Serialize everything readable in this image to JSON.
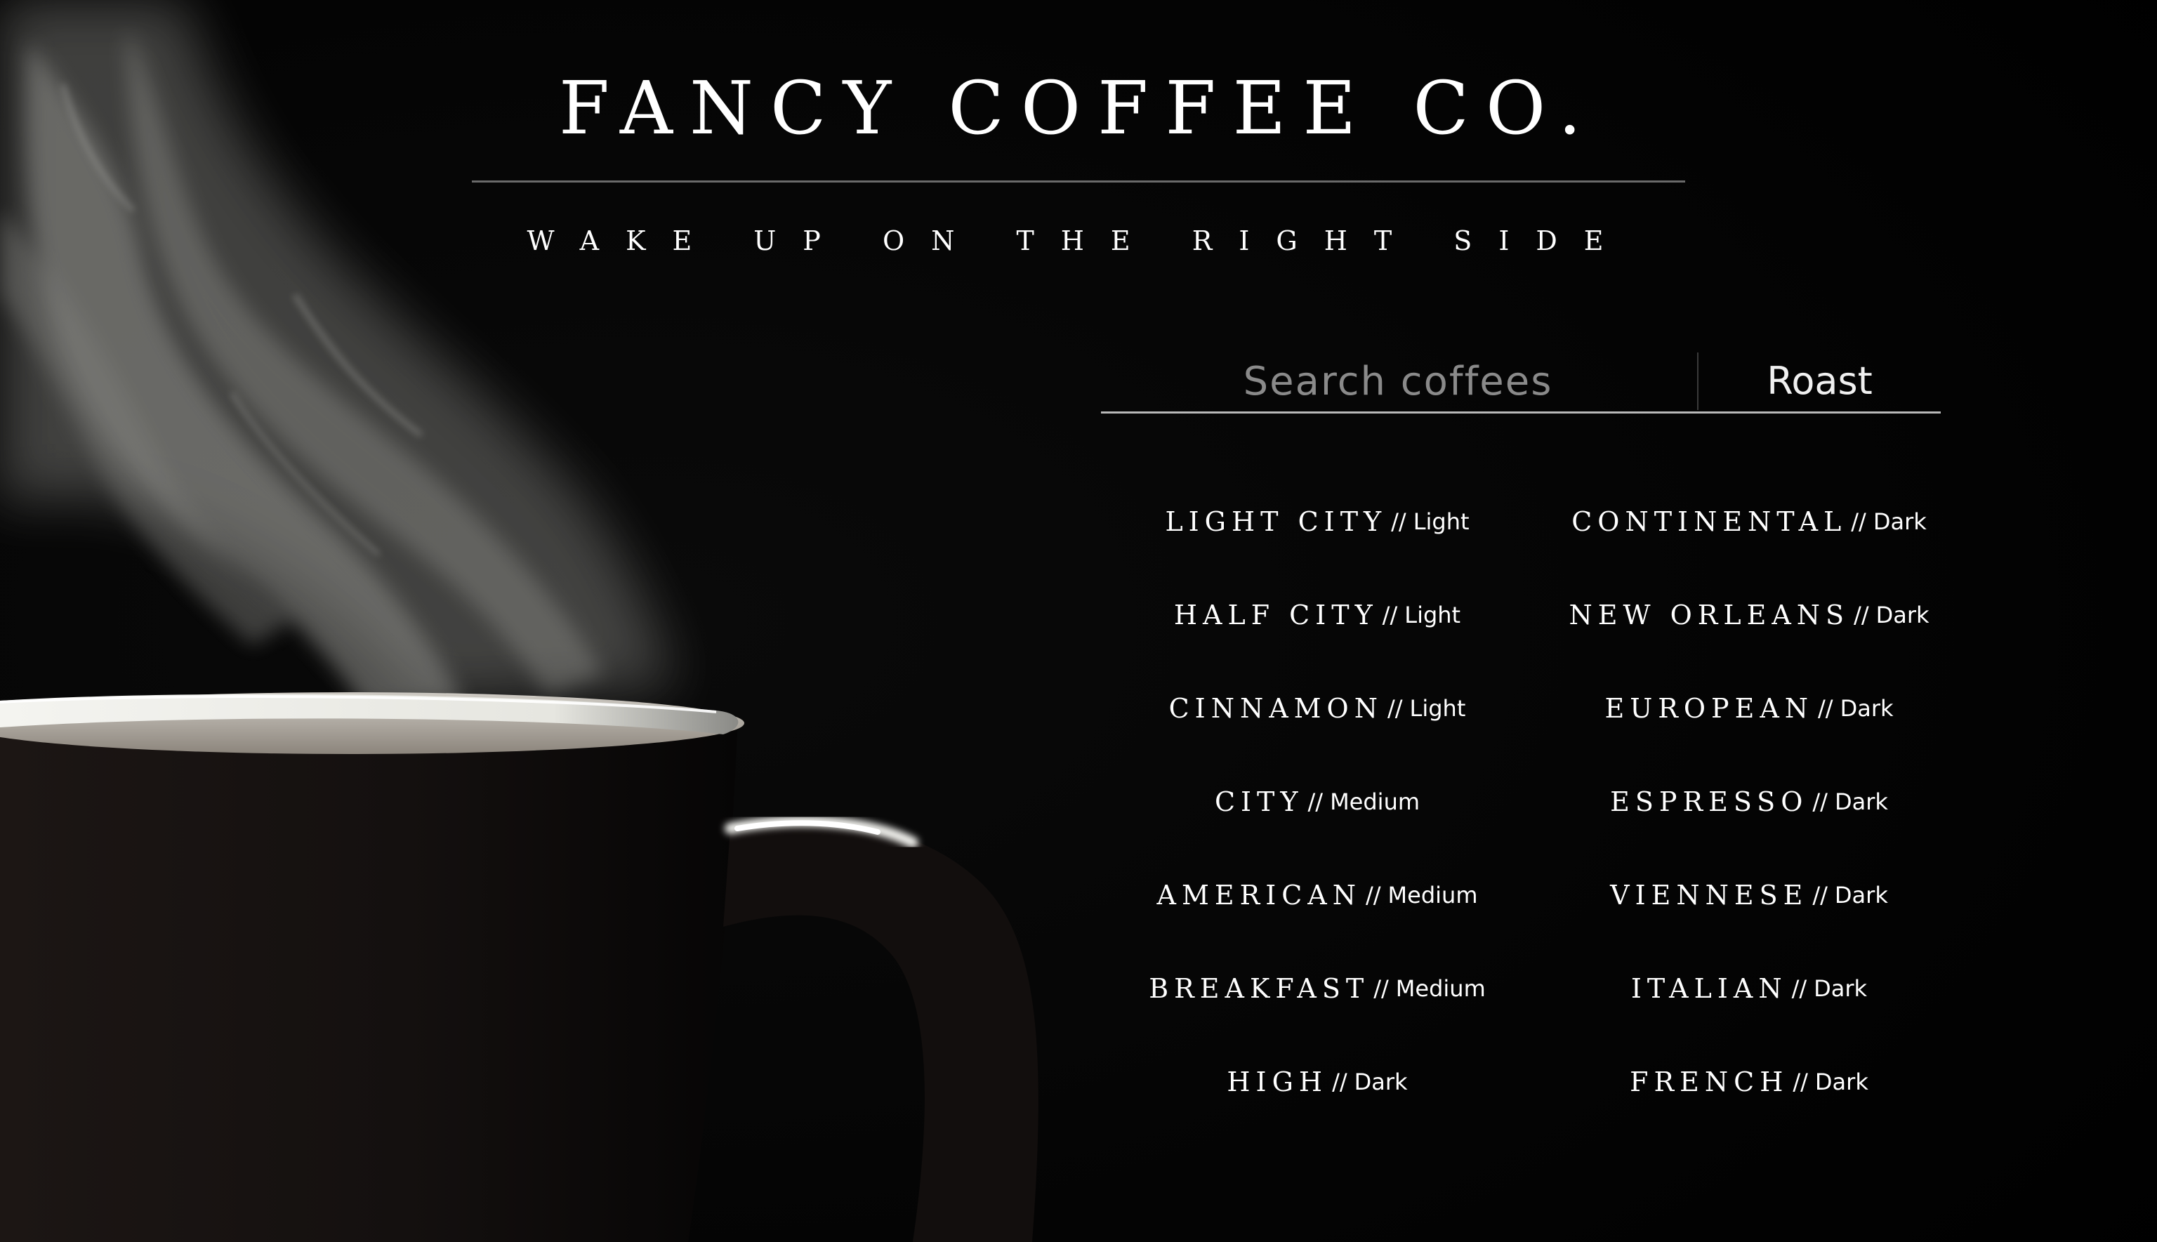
{
  "header": {
    "brand": "FANCY COFFEE CO.",
    "tagline": "WAKE UP ON THE RIGHT SIDE"
  },
  "search": {
    "placeholder": "Search coffees",
    "value": "",
    "roast_label": "Roast"
  },
  "hero": {
    "subject": "steaming coffee mug"
  },
  "coffees": {
    "separator": "//",
    "items": [
      {
        "name": "LIGHT CITY",
        "roast": "Light"
      },
      {
        "name": "CONTINENTAL",
        "roast": "Dark"
      },
      {
        "name": "HALF CITY",
        "roast": "Light"
      },
      {
        "name": "NEW ORLEANS",
        "roast": "Dark"
      },
      {
        "name": "CINNAMON",
        "roast": "Light"
      },
      {
        "name": "EUROPEAN",
        "roast": "Dark"
      },
      {
        "name": "CITY",
        "roast": "Medium"
      },
      {
        "name": "ESPRESSO",
        "roast": "Dark"
      },
      {
        "name": "AMERICAN",
        "roast": "Medium"
      },
      {
        "name": "VIENNESE",
        "roast": "Dark"
      },
      {
        "name": "BREAKFAST",
        "roast": "Medium"
      },
      {
        "name": "ITALIAN",
        "roast": "Dark"
      },
      {
        "name": "HIGH",
        "roast": "Dark"
      },
      {
        "name": "FRENCH",
        "roast": "Dark"
      }
    ]
  },
  "colors": {
    "background": "#030303",
    "text": "#ffffff",
    "placeholder": "#8a8a8a",
    "rule": "#6a6a6a"
  }
}
